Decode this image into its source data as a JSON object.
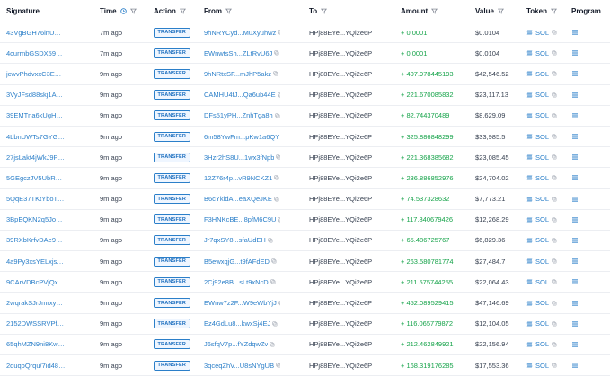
{
  "columns": {
    "signature": "Signature",
    "time": "Time",
    "action": "Action",
    "from": "From",
    "to": "To",
    "amount": "Amount",
    "value": "Value",
    "token": "Token",
    "program": "Program"
  },
  "colors": {
    "link": "#2b7fc9",
    "positive": "#16a34a",
    "badge_border": "#2b7fc9"
  },
  "rows": [
    {
      "signature": "43VgBGH76inUNRf...",
      "time": "7m ago",
      "action": "TRANSFER",
      "from": "9hNRYCyd...MuXyuhwz",
      "to": "HPj88EYe...YQi2e6Pa",
      "amount": "+ 0.0001",
      "value": "$0.0104",
      "token": "SOL"
    },
    {
      "signature": "4currnbGSDX5951...",
      "time": "7m ago",
      "action": "TRANSFER",
      "from": "EWnwtsSh...ZLtRvU6J",
      "to": "HPj88EYe...YQi2e6Pa",
      "amount": "+ 0.0001",
      "value": "$0.0104",
      "token": "SOL"
    },
    {
      "signature": "jcwvPhdvxxC3EHNk...",
      "time": "9m ago",
      "action": "TRANSFER",
      "from": "9hNRtxSF...mJhP5akz",
      "to": "HPj88EYe...YQi2e6Pa",
      "amount": "+ 407.978445193",
      "value": "$42,546.52",
      "token": "SOL"
    },
    {
      "signature": "3VyJFsd88skj1AvB...",
      "time": "9m ago",
      "action": "TRANSFER",
      "from": "CAMHU4fJ...Qa6ub44E",
      "to": "HPj88EYe...YQi2e6Pa",
      "amount": "+ 221.670085832",
      "value": "$23,117.13",
      "token": "SOL"
    },
    {
      "signature": "39EMTna6kUgHhRi...",
      "time": "9m ago",
      "action": "TRANSFER",
      "from": "DFs51yPH...ZnhTga8h",
      "to": "HPj88EYe...YQi2e6Pa",
      "amount": "+ 82.744370489",
      "value": "$8,629.09",
      "token": "SOL"
    },
    {
      "signature": "4LbnUWTs7GYGQg...",
      "time": "9m ago",
      "action": "TRANSFER",
      "from": "6m58YwFm...pKw1a6QY",
      "to": "HPj88EYe...YQi2e6Pa",
      "amount": "+ 325.886848299",
      "value": "$33,985.5",
      "token": "SOL"
    },
    {
      "signature": "27jsLakt4jWkJ9Pthr...",
      "time": "9m ago",
      "action": "TRANSFER",
      "from": "3Hzr2hS8U...1wx3fNpb",
      "to": "HPj88EYe...YQi2e6Pa",
      "amount": "+ 221.368385682",
      "value": "$23,085.45",
      "token": "SOL"
    },
    {
      "signature": "5GEgczJV5UbRbCR...",
      "time": "9m ago",
      "action": "TRANSFER",
      "from": "12Z76r4p...vR9NCKZ1",
      "to": "HPj88EYe...YQi2e6Pa",
      "amount": "+ 236.886852976",
      "value": "$24,704.02",
      "token": "SOL"
    },
    {
      "signature": "5QqE37TKtYboTre...",
      "time": "9m ago",
      "action": "TRANSFER",
      "from": "B6cYkidA...eaXQeJKE",
      "to": "HPj88EYe...YQi2e6Pa",
      "amount": "+ 74.537328632",
      "value": "$7,773.21",
      "token": "SOL"
    },
    {
      "signature": "3BpEQKN2q5JoNN...",
      "time": "9m ago",
      "action": "TRANSFER",
      "from": "F3HNKcBE...8pfM6C9U",
      "to": "HPj88EYe...YQi2e6Pa",
      "amount": "+ 117.840679426",
      "value": "$12,268.29",
      "token": "SOL"
    },
    {
      "signature": "39RXbKrfvDAe9FD...",
      "time": "9m ago",
      "action": "TRANSFER",
      "from": "Jr7qxSY8...sfaUdEH",
      "to": "HPj88EYe...YQi2e6Pa",
      "amount": "+ 65.486725767",
      "value": "$6,829.36",
      "token": "SOL"
    },
    {
      "signature": "4a9Py3xsYELxjsQx...",
      "time": "9m ago",
      "action": "TRANSFER",
      "from": "B5ewxqjG...t9fAFdED",
      "to": "HPj88EYe...YQi2e6Pa",
      "amount": "+ 263.580781774",
      "value": "$27,484.7",
      "token": "SOL"
    },
    {
      "signature": "9CArVDBcPVjQxZZ...",
      "time": "9m ago",
      "action": "TRANSFER",
      "from": "2Cj92e8B...sLt9xNcD",
      "to": "HPj88EYe...YQi2e6Pa",
      "amount": "+ 211.575744255",
      "value": "$22,064.43",
      "token": "SOL"
    },
    {
      "signature": "2wqrakSJrJmrxyaiTo...",
      "time": "9m ago",
      "action": "TRANSFER",
      "from": "EWnw7z2F...W9eWbYjJ",
      "to": "HPj88EYe...YQi2e6Pa",
      "amount": "+ 452.089529415",
      "value": "$47,146.69",
      "token": "SOL"
    },
    {
      "signature": "2152DWSSRVPfrU3...",
      "time": "9m ago",
      "action": "TRANSFER",
      "from": "Ez4GdLu8...kwxSj4EJ",
      "to": "HPj88EYe...YQi2e6Pa",
      "amount": "+ 116.065779872",
      "value": "$12,104.05",
      "token": "SOL"
    },
    {
      "signature": "65qhMZN9ni8Kw6F...",
      "time": "9m ago",
      "action": "TRANSFER",
      "from": "J6sfqV7p...fYZdqwZv",
      "to": "HPj88EYe...YQi2e6Pa",
      "amount": "+ 212.462849921",
      "value": "$22,156.94",
      "token": "SOL"
    },
    {
      "signature": "2duqoQrqu/7id48d...",
      "time": "9m ago",
      "action": "TRANSFER",
      "from": "3qceqZhV...U8sNYgUB",
      "to": "HPj88EYe...YQi2e6Pa",
      "amount": "+ 168.319176285",
      "value": "$17,553.36",
      "token": "SOL"
    }
  ]
}
